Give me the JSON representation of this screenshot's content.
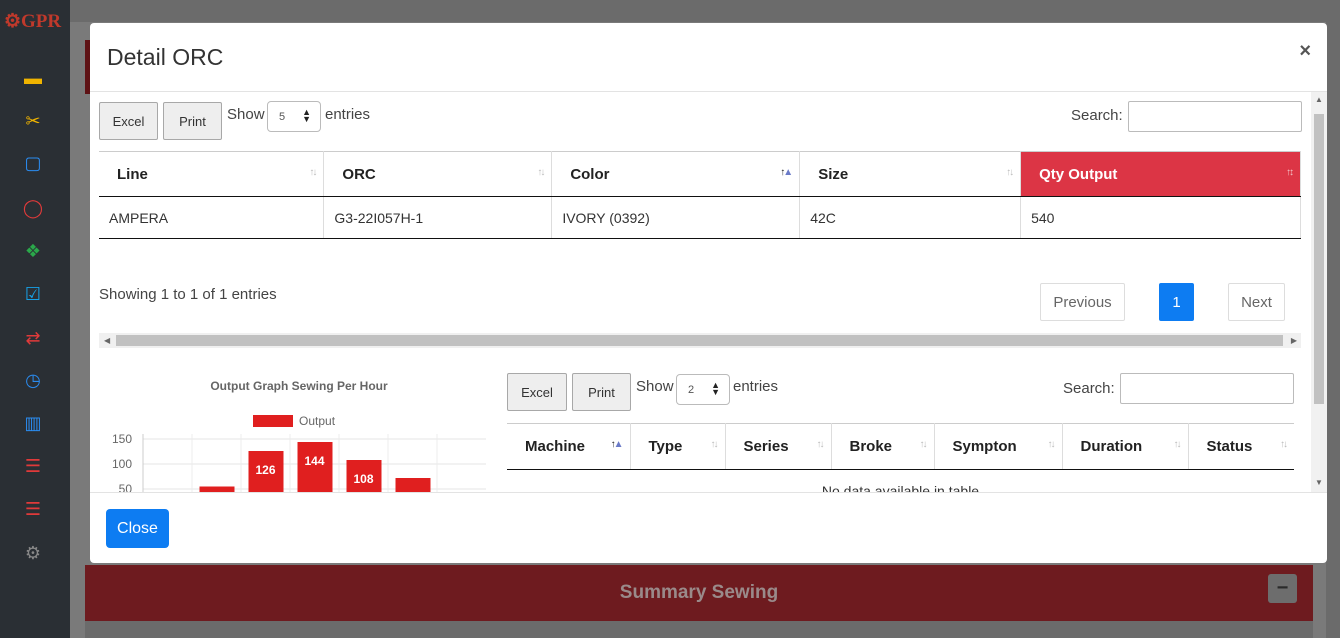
{
  "app": {
    "logo": "⚙GPR"
  },
  "sidebar": {
    "icons": [
      {
        "name": "briefcase-icon",
        "glyph": "▬",
        "color": "#f0b400"
      },
      {
        "name": "scissors-icon",
        "glyph": "✂",
        "color": "#f0b400"
      },
      {
        "name": "square-icon",
        "glyph": "▢",
        "color": "#2a8cf0"
      },
      {
        "name": "circle-icon",
        "glyph": "◯",
        "color": "#e03a3a"
      },
      {
        "name": "cubes-icon",
        "glyph": "❖",
        "color": "#2aa84a"
      },
      {
        "name": "checkbox-icon",
        "glyph": "☑",
        "color": "#17a2e8"
      },
      {
        "name": "exchange-icon",
        "glyph": "⇄",
        "color": "#e03a3a"
      },
      {
        "name": "clock-icon",
        "glyph": "◷",
        "color": "#2a8cf0"
      },
      {
        "name": "barcode-icon",
        "glyph": "▥",
        "color": "#2a8cf0"
      },
      {
        "name": "list-icon",
        "glyph": "☰",
        "color": "#e03a3a"
      },
      {
        "name": "list-alt-icon",
        "glyph": "☰",
        "color": "#e03a3a"
      },
      {
        "name": "gears-icon",
        "glyph": "⚙",
        "color": "#888888"
      }
    ]
  },
  "background": {
    "summary_title": "Summary Sewing",
    "summary_toggle": "−"
  },
  "modal": {
    "title": "Detail ORC",
    "close_symbol": "×",
    "footer_close": "Close"
  },
  "table1": {
    "excel": "Excel",
    "print": "Print",
    "show": "Show",
    "entries_value": "5",
    "entries": "entries",
    "search_label": "Search:",
    "columns": [
      "Line",
      "ORC",
      "Color",
      "Size",
      "Qty Output"
    ],
    "rows": [
      [
        "AMPERA",
        "G3-22I057H-1",
        "IVORY (0392)",
        "42C",
        "540"
      ]
    ],
    "info": "Showing 1 to 1 of 1 entries",
    "pagination": {
      "previous": "Previous",
      "page": "1",
      "next": "Next"
    }
  },
  "table2": {
    "excel": "Excel",
    "print": "Print",
    "show": "Show",
    "entries_value": "2",
    "entries": "entries",
    "search_label": "Search:",
    "columns": [
      "Machine",
      "Type",
      "Series",
      "Broke",
      "Sympton",
      "Duration",
      "Status"
    ],
    "empty": "No data available in table"
  },
  "chart_data": {
    "type": "bar",
    "title": "Output Graph Sewing Per Hour",
    "series": [
      {
        "name": "Output",
        "values": [
          55,
          126,
          144,
          108,
          72
        ]
      }
    ],
    "data_labels": [
      "",
      "126",
      "144",
      "108",
      "72"
    ],
    "yticks": [
      "150",
      "100",
      "50"
    ],
    "ylim": [
      0,
      160
    ],
    "color": "#e01f1f"
  }
}
